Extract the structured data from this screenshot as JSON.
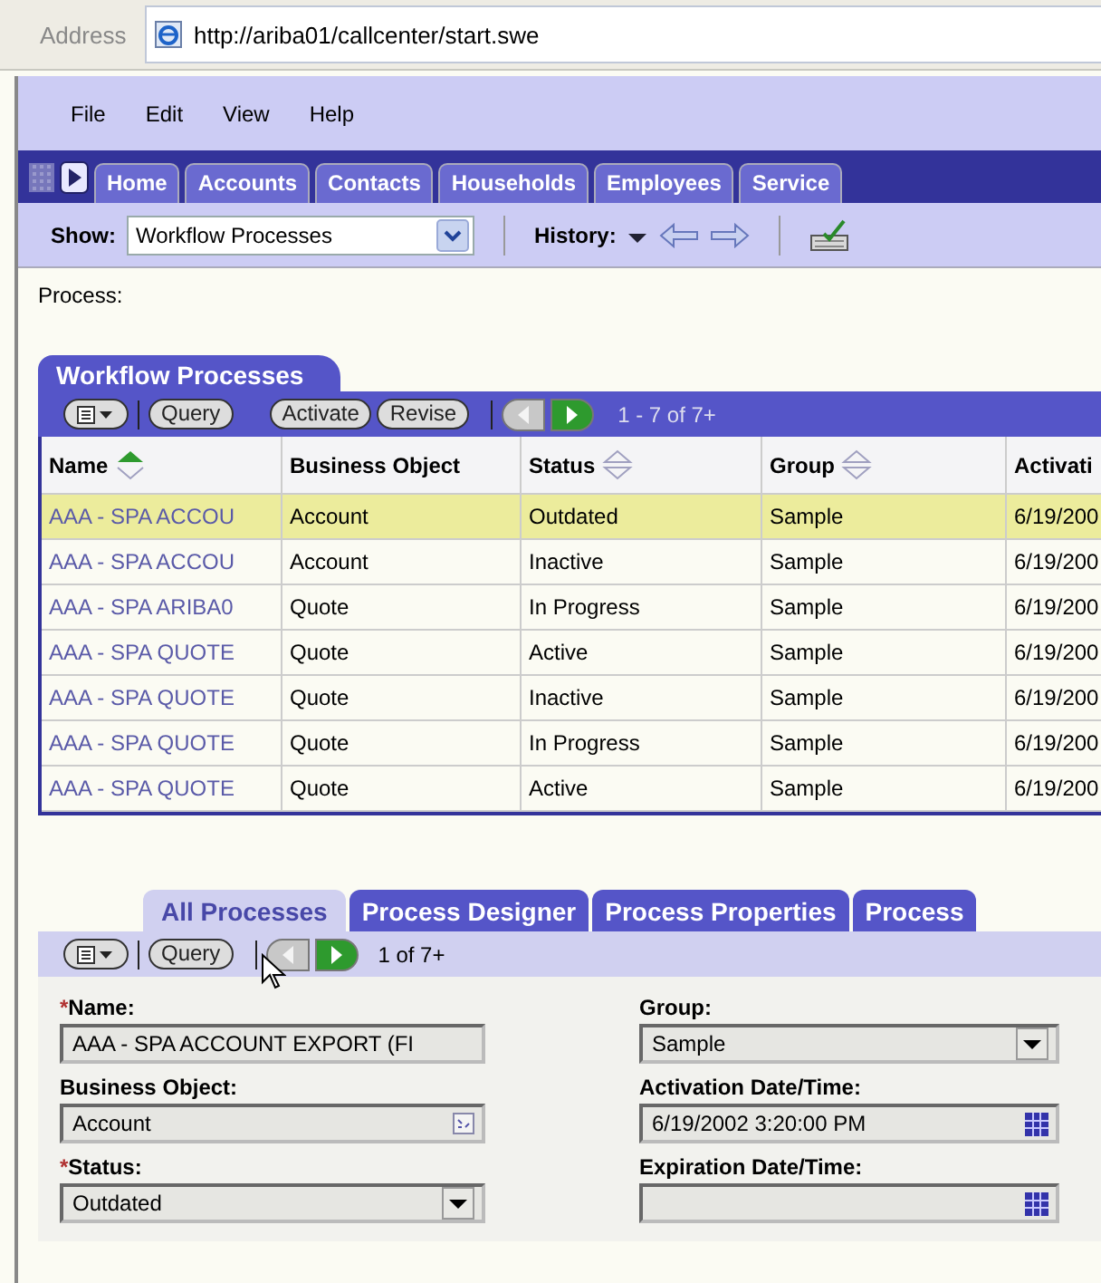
{
  "address_bar": {
    "label": "Address",
    "url": "http://ariba01/callcenter/start.swe"
  },
  "menu": [
    "File",
    "Edit",
    "View",
    "Help"
  ],
  "tabs": [
    {
      "label": "Home"
    },
    {
      "label": "Accounts"
    },
    {
      "label": "Contacts"
    },
    {
      "label": "Households"
    },
    {
      "label": "Employees"
    },
    {
      "label": "Service"
    }
  ],
  "show_bar": {
    "label": "Show:",
    "value": "Workflow Processes",
    "history_label": "History:"
  },
  "breadcrumb": "Process:",
  "list_applet": {
    "title": "Workflow Processes",
    "toolbar": {
      "button_groups": [
        [
          "Query"
        ],
        [
          "Activate",
          "Revise"
        ]
      ],
      "prev_enabled": false,
      "next_enabled": true,
      "count": "1 - 7 of 7+"
    },
    "columns": [
      {
        "label": "Name",
        "sort_ascending": true
      },
      {
        "label": "Business Object"
      },
      {
        "label": "Status",
        "sort_ascending": false
      },
      {
        "label": "Group",
        "sort_ascending": false
      },
      {
        "label": "Activati"
      }
    ],
    "rows": [
      {
        "selected": true,
        "cells": [
          "AAA - SPA ACCOU",
          "Account",
          "Outdated",
          "Sample",
          "6/19/200"
        ]
      },
      {
        "selected": false,
        "cells": [
          "AAA - SPA ACCOU",
          "Account",
          "Inactive",
          "Sample",
          "6/19/200"
        ]
      },
      {
        "selected": false,
        "cells": [
          "AAA - SPA ARIBA0",
          "Quote",
          "In Progress",
          "Sample",
          "6/19/200"
        ]
      },
      {
        "selected": false,
        "cells": [
          "AAA - SPA QUOTE",
          "Quote",
          "Active",
          "Sample",
          "6/19/200"
        ]
      },
      {
        "selected": false,
        "cells": [
          "AAA - SPA QUOTE",
          "Quote",
          "Inactive",
          "Sample",
          "6/19/200"
        ]
      },
      {
        "selected": false,
        "cells": [
          "AAA - SPA QUOTE",
          "Quote",
          "In Progress",
          "Sample",
          "6/19/200"
        ]
      },
      {
        "selected": false,
        "cells": [
          "AAA - SPA QUOTE",
          "Quote",
          "Active",
          "Sample",
          "6/19/200"
        ]
      }
    ]
  },
  "form_applet": {
    "tabs": [
      {
        "label": "All Processes",
        "selected": true
      },
      {
        "label": "Process Designer",
        "selected": false
      },
      {
        "label": "Process Properties",
        "selected": false
      },
      {
        "label": "Process",
        "selected": false
      }
    ],
    "toolbar": {
      "button_groups": [
        [
          "Query"
        ]
      ],
      "prev_enabled": false,
      "next_enabled": true,
      "count": "1 of 7+"
    },
    "fields": [
      {
        "label": "Name:",
        "required_mark": "*",
        "kind": "text",
        "value": "AAA - SPA ACCOUNT EXPORT (FI"
      },
      {
        "label": "Group:",
        "kind": "dropdown",
        "value": "Sample"
      },
      {
        "label": "Business Object:",
        "kind": "picker",
        "value": "Account"
      },
      {
        "label": "Activation Date/Time:",
        "kind": "date",
        "value": "6/19/2002 3:20:00 PM"
      },
      {
        "label": "Status:",
        "required_mark": "*",
        "kind": "dropdown",
        "value": "Outdated"
      },
      {
        "label": "Expiration Date/Time:",
        "kind": "date"
      }
    ]
  }
}
